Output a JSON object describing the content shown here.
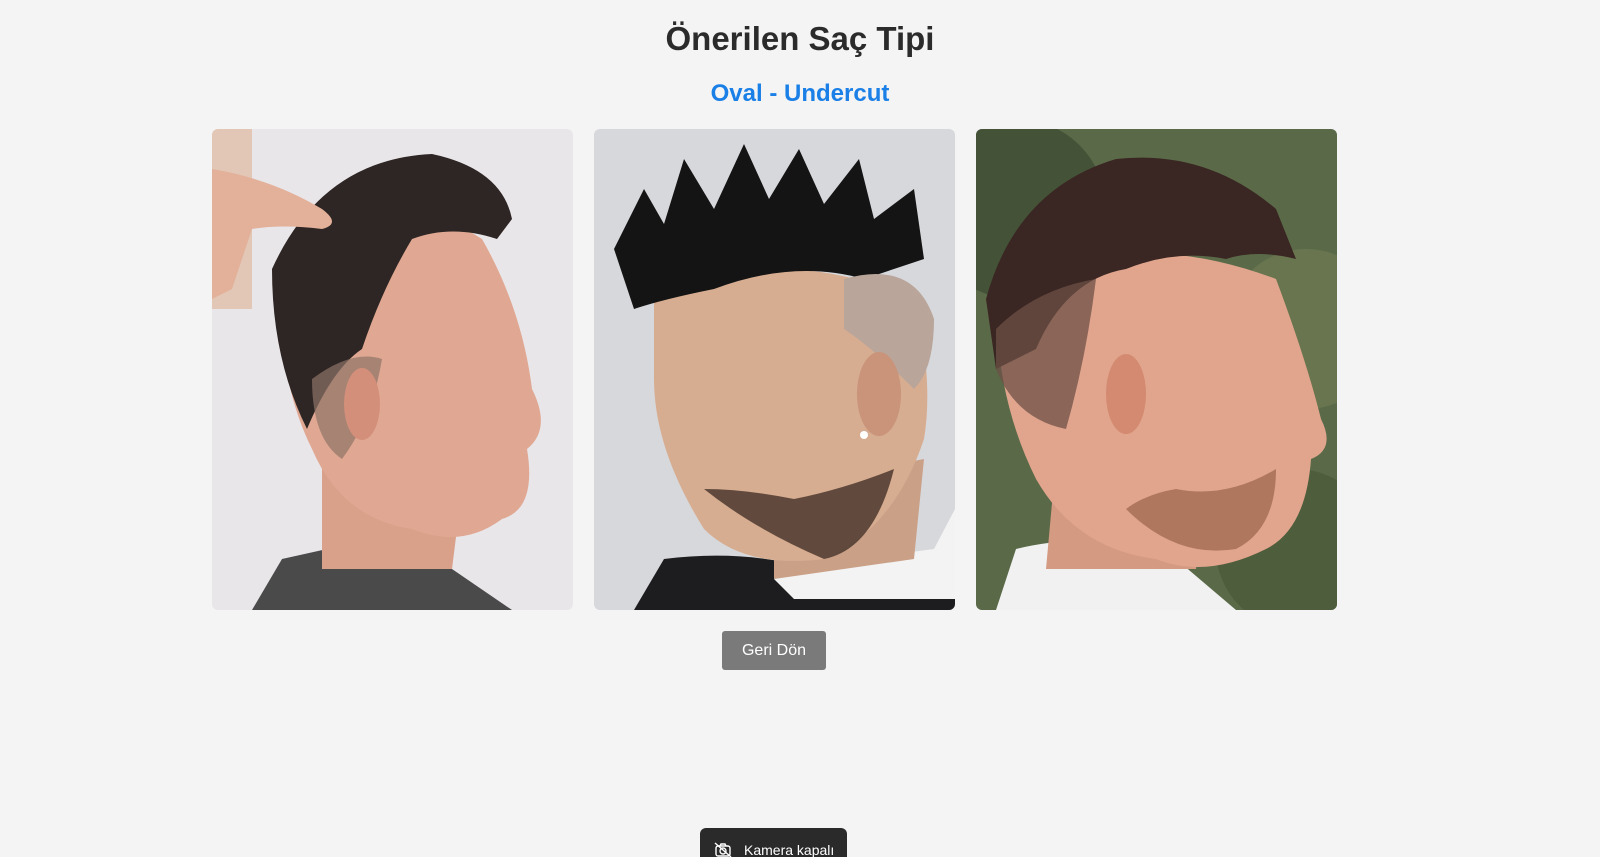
{
  "header": {
    "title": "Önerilen Saç Tipi",
    "subtitle": "Oval - Undercut"
  },
  "gallery": {
    "photos": [
      {
        "icon": "hairstyle-photo-1"
      },
      {
        "icon": "hairstyle-photo-2"
      },
      {
        "icon": "hairstyle-photo-3"
      }
    ]
  },
  "actions": {
    "back_label": "Geri Dön"
  },
  "toast": {
    "camera_status": "Kamera kapalı",
    "icon": "camera-off-icon"
  },
  "colors": {
    "accent": "#1a7fe6",
    "button": "#7a7a7a",
    "background": "#f4f4f4"
  }
}
